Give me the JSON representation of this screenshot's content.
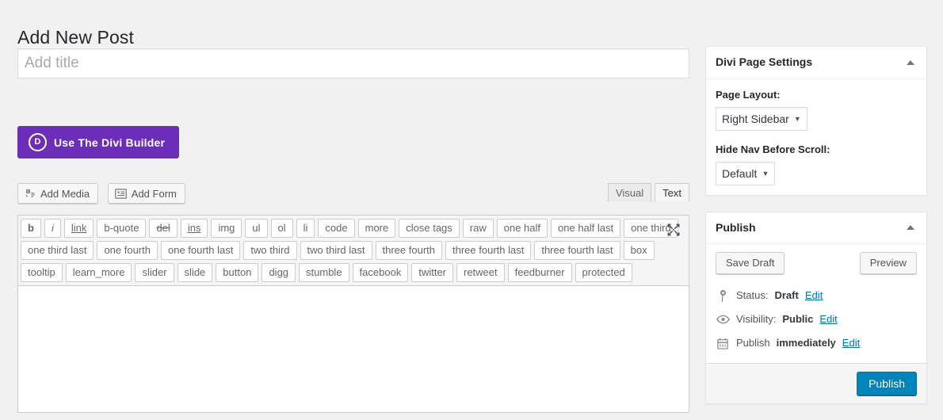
{
  "page": {
    "title": "Add New Post"
  },
  "title_field": {
    "placeholder": "Add title",
    "value": ""
  },
  "divi_builder": {
    "label": "Use The Divi Builder",
    "icon_letter": "D",
    "color": "#6c2eb9"
  },
  "editor": {
    "media_buttons": [
      {
        "label": "Add Media",
        "icon": "media-icon"
      },
      {
        "label": "Add Form",
        "icon": "form-icon"
      }
    ],
    "tabs": [
      {
        "label": "Visual",
        "active": false
      },
      {
        "label": "Text",
        "active": true
      }
    ],
    "fullscreen_icon": "fullscreen-expand-icon",
    "content": "",
    "quicktags": {
      "row1": [
        {
          "label": "b",
          "style": "bold"
        },
        {
          "label": "i",
          "style": "italic"
        },
        {
          "label": "link",
          "style": "link"
        },
        {
          "label": "b-quote",
          "style": ""
        },
        {
          "label": "del",
          "style": "del"
        },
        {
          "label": "ins",
          "style": "ins"
        },
        {
          "label": "img",
          "style": ""
        },
        {
          "label": "ul",
          "style": ""
        },
        {
          "label": "ol",
          "style": ""
        },
        {
          "label": "li",
          "style": ""
        },
        {
          "label": "code",
          "style": ""
        },
        {
          "label": "more",
          "style": ""
        },
        {
          "label": "close tags",
          "style": ""
        },
        {
          "label": "raw",
          "style": ""
        },
        {
          "label": "one half",
          "style": ""
        },
        {
          "label": "one half last",
          "style": ""
        },
        {
          "label": "one third",
          "style": ""
        }
      ],
      "row2": [
        {
          "label": "one third last",
          "style": ""
        },
        {
          "label": "one fourth",
          "style": ""
        },
        {
          "label": "one fourth last",
          "style": ""
        },
        {
          "label": "two third",
          "style": ""
        },
        {
          "label": "two third last",
          "style": ""
        },
        {
          "label": "three fourth",
          "style": ""
        },
        {
          "label": "three fourth last",
          "style": ""
        },
        {
          "label": "three fourth last",
          "style": ""
        },
        {
          "label": "box",
          "style": ""
        }
      ],
      "row3": [
        {
          "label": "tooltip",
          "style": ""
        },
        {
          "label": "learn_more",
          "style": ""
        },
        {
          "label": "slider",
          "style": ""
        },
        {
          "label": "slide",
          "style": ""
        },
        {
          "label": "button",
          "style": ""
        },
        {
          "label": "digg",
          "style": ""
        },
        {
          "label": "stumble",
          "style": ""
        },
        {
          "label": "facebook",
          "style": ""
        },
        {
          "label": "twitter",
          "style": ""
        },
        {
          "label": "retweet",
          "style": ""
        },
        {
          "label": "feedburner",
          "style": ""
        },
        {
          "label": "protected",
          "style": ""
        }
      ]
    }
  },
  "divi_page_settings": {
    "header": "Divi Page Settings",
    "toggle_icon": "chevron-up-icon",
    "page_layout": {
      "label": "Page Layout:",
      "value": "Right Sidebar"
    },
    "hide_nav": {
      "label": "Hide Nav Before Scroll:",
      "value": "Default"
    }
  },
  "publish_box": {
    "header": "Publish",
    "toggle_icon": "chevron-up-icon",
    "save_draft_label": "Save Draft",
    "preview_label": "Preview",
    "status": {
      "icon": "pin-icon",
      "prefix": "Status:",
      "value": "Draft",
      "edit_label": "Edit"
    },
    "visibility": {
      "icon": "eye-icon",
      "prefix": "Visibility:",
      "value": "Public",
      "edit_label": "Edit"
    },
    "schedule": {
      "icon": "calendar-icon",
      "prefix": "Publish",
      "value": "immediately",
      "edit_label": "Edit"
    },
    "publish_label": "Publish",
    "publish_color": "#0085ba"
  }
}
